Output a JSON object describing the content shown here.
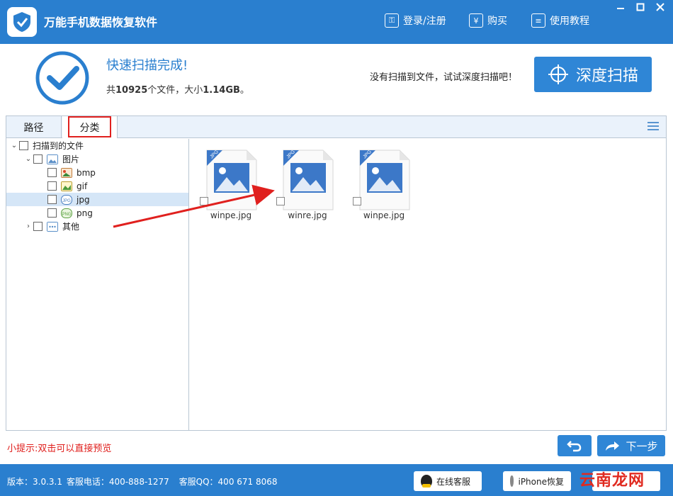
{
  "app": {
    "title": "万能手机数据恢复软件",
    "links": [
      {
        "label": "登录/注册",
        "icon": "user-key-icon"
      },
      {
        "label": "购买",
        "icon": "yen-icon"
      },
      {
        "label": "使用教程",
        "icon": "document-icon"
      }
    ],
    "window_buttons": [
      "minimize",
      "maximize",
      "close"
    ]
  },
  "header": {
    "status_title": "快速扫描完成!",
    "summary_prefix": "共",
    "file_count": "10925",
    "summary_mid": "个文件，大小",
    "total_size": "1.14GB",
    "summary_suffix": "。",
    "deep_hint": "没有扫描到文件，试试深度扫描吧！",
    "deep_scan_label": "深度扫描"
  },
  "tabs": [
    {
      "label": "路径",
      "active": false
    },
    {
      "label": "分类",
      "active": true
    }
  ],
  "tree": {
    "root": {
      "label": "扫描到的文件",
      "expanded": true
    },
    "images": {
      "label": "图片",
      "expanded": true
    },
    "image_types": [
      {
        "label": "bmp",
        "icon": "bmp-icon",
        "selected": false
      },
      {
        "label": "gif",
        "icon": "gif-icon",
        "selected": false
      },
      {
        "label": "jpg",
        "icon": "jpg-icon",
        "selected": true
      },
      {
        "label": "png",
        "icon": "png-icon",
        "selected": false
      }
    ],
    "other": {
      "label": "其他",
      "expanded": false
    }
  },
  "files": [
    {
      "name": "winpe.jpg",
      "badge": "JPG"
    },
    {
      "name": "winre.jpg",
      "badge": "JPG"
    },
    {
      "name": "winpe.jpg",
      "badge": "JPG"
    }
  ],
  "bottom": {
    "hint": "小提示:双击可以直接预览",
    "next_label": "下一步"
  },
  "footer": {
    "version_label": "版本：3.0.3.1",
    "phone_label": "客服电话：400-888-1277",
    "qq_label": "客服QQ：400 671 8068",
    "online_service_label": "在线客服",
    "iphone_recover_label": "iPhone恢复",
    "watermark": "云南龙网"
  },
  "colors": {
    "brand_blue": "#2a7fcf",
    "highlight_red": "#e0201e",
    "selected_row": "#d5e6f7"
  }
}
